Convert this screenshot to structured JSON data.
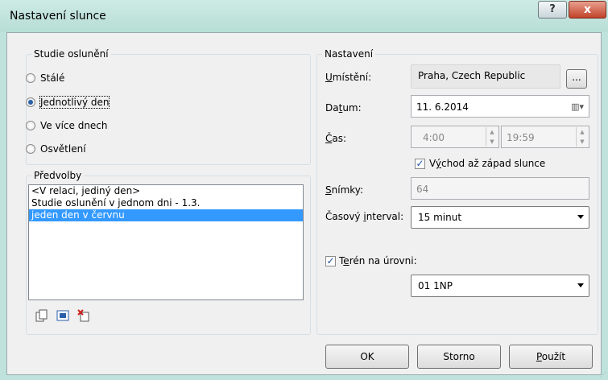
{
  "window": {
    "title": "Nastavení slunce",
    "help_label": "?",
    "close_label": "x"
  },
  "study": {
    "legend": "Studie oslunění",
    "options": [
      {
        "label": "Stálé",
        "selected": false
      },
      {
        "label": "Jednotlivý den",
        "selected": true
      },
      {
        "label": "Ve více dnech",
        "selected": false
      },
      {
        "label": "Osvětlení",
        "selected": false
      }
    ]
  },
  "presets": {
    "legend": "Předvolby",
    "items": [
      {
        "label": "<V relaci, jediný den>",
        "selected": false
      },
      {
        "label": "Studie oslunění v jednom dni - 1.3.",
        "selected": false
      },
      {
        "label": "jeden den v červnu",
        "selected": true
      }
    ],
    "icons": [
      "duplicate-icon",
      "rename-icon",
      "delete-icon"
    ]
  },
  "settings": {
    "legend": "Nastavení",
    "location_label_u": "U",
    "location_label_rest": "místění:",
    "location_value": "Praha, Czech Republic",
    "browse_label": "...",
    "date_label_pre": "Da",
    "date_label_u": "t",
    "date_label_post": "um:",
    "date_value": "11.  6.2014",
    "time_label_u": "Č",
    "time_label_rest": "as:",
    "time_start": "4:00",
    "time_end": "19:59",
    "sunrise_checked": true,
    "sunrise_label_pre": "V",
    "sunrise_label_u": "ý",
    "sunrise_label_post": "chod až západ slunce",
    "frames_label_u": "S",
    "frames_label_rest": "nímky:",
    "frames_value": "64",
    "interval_label_pre": "Časový ",
    "interval_label_u": "i",
    "interval_label_post": "nterval:",
    "interval_value": "15 minut",
    "terrain_checked": true,
    "terrain_label_pre": "T",
    "terrain_label_u": "e",
    "terrain_label_post": "rén na úrovni:",
    "level_value": "01 1NP"
  },
  "buttons": {
    "ok": "OK",
    "cancel": "Storno",
    "apply_u": "P",
    "apply_rest": "oužít"
  },
  "colors": {
    "selection": "#3399ff",
    "close": "#c2432b",
    "frame": "#bfe3dc"
  }
}
